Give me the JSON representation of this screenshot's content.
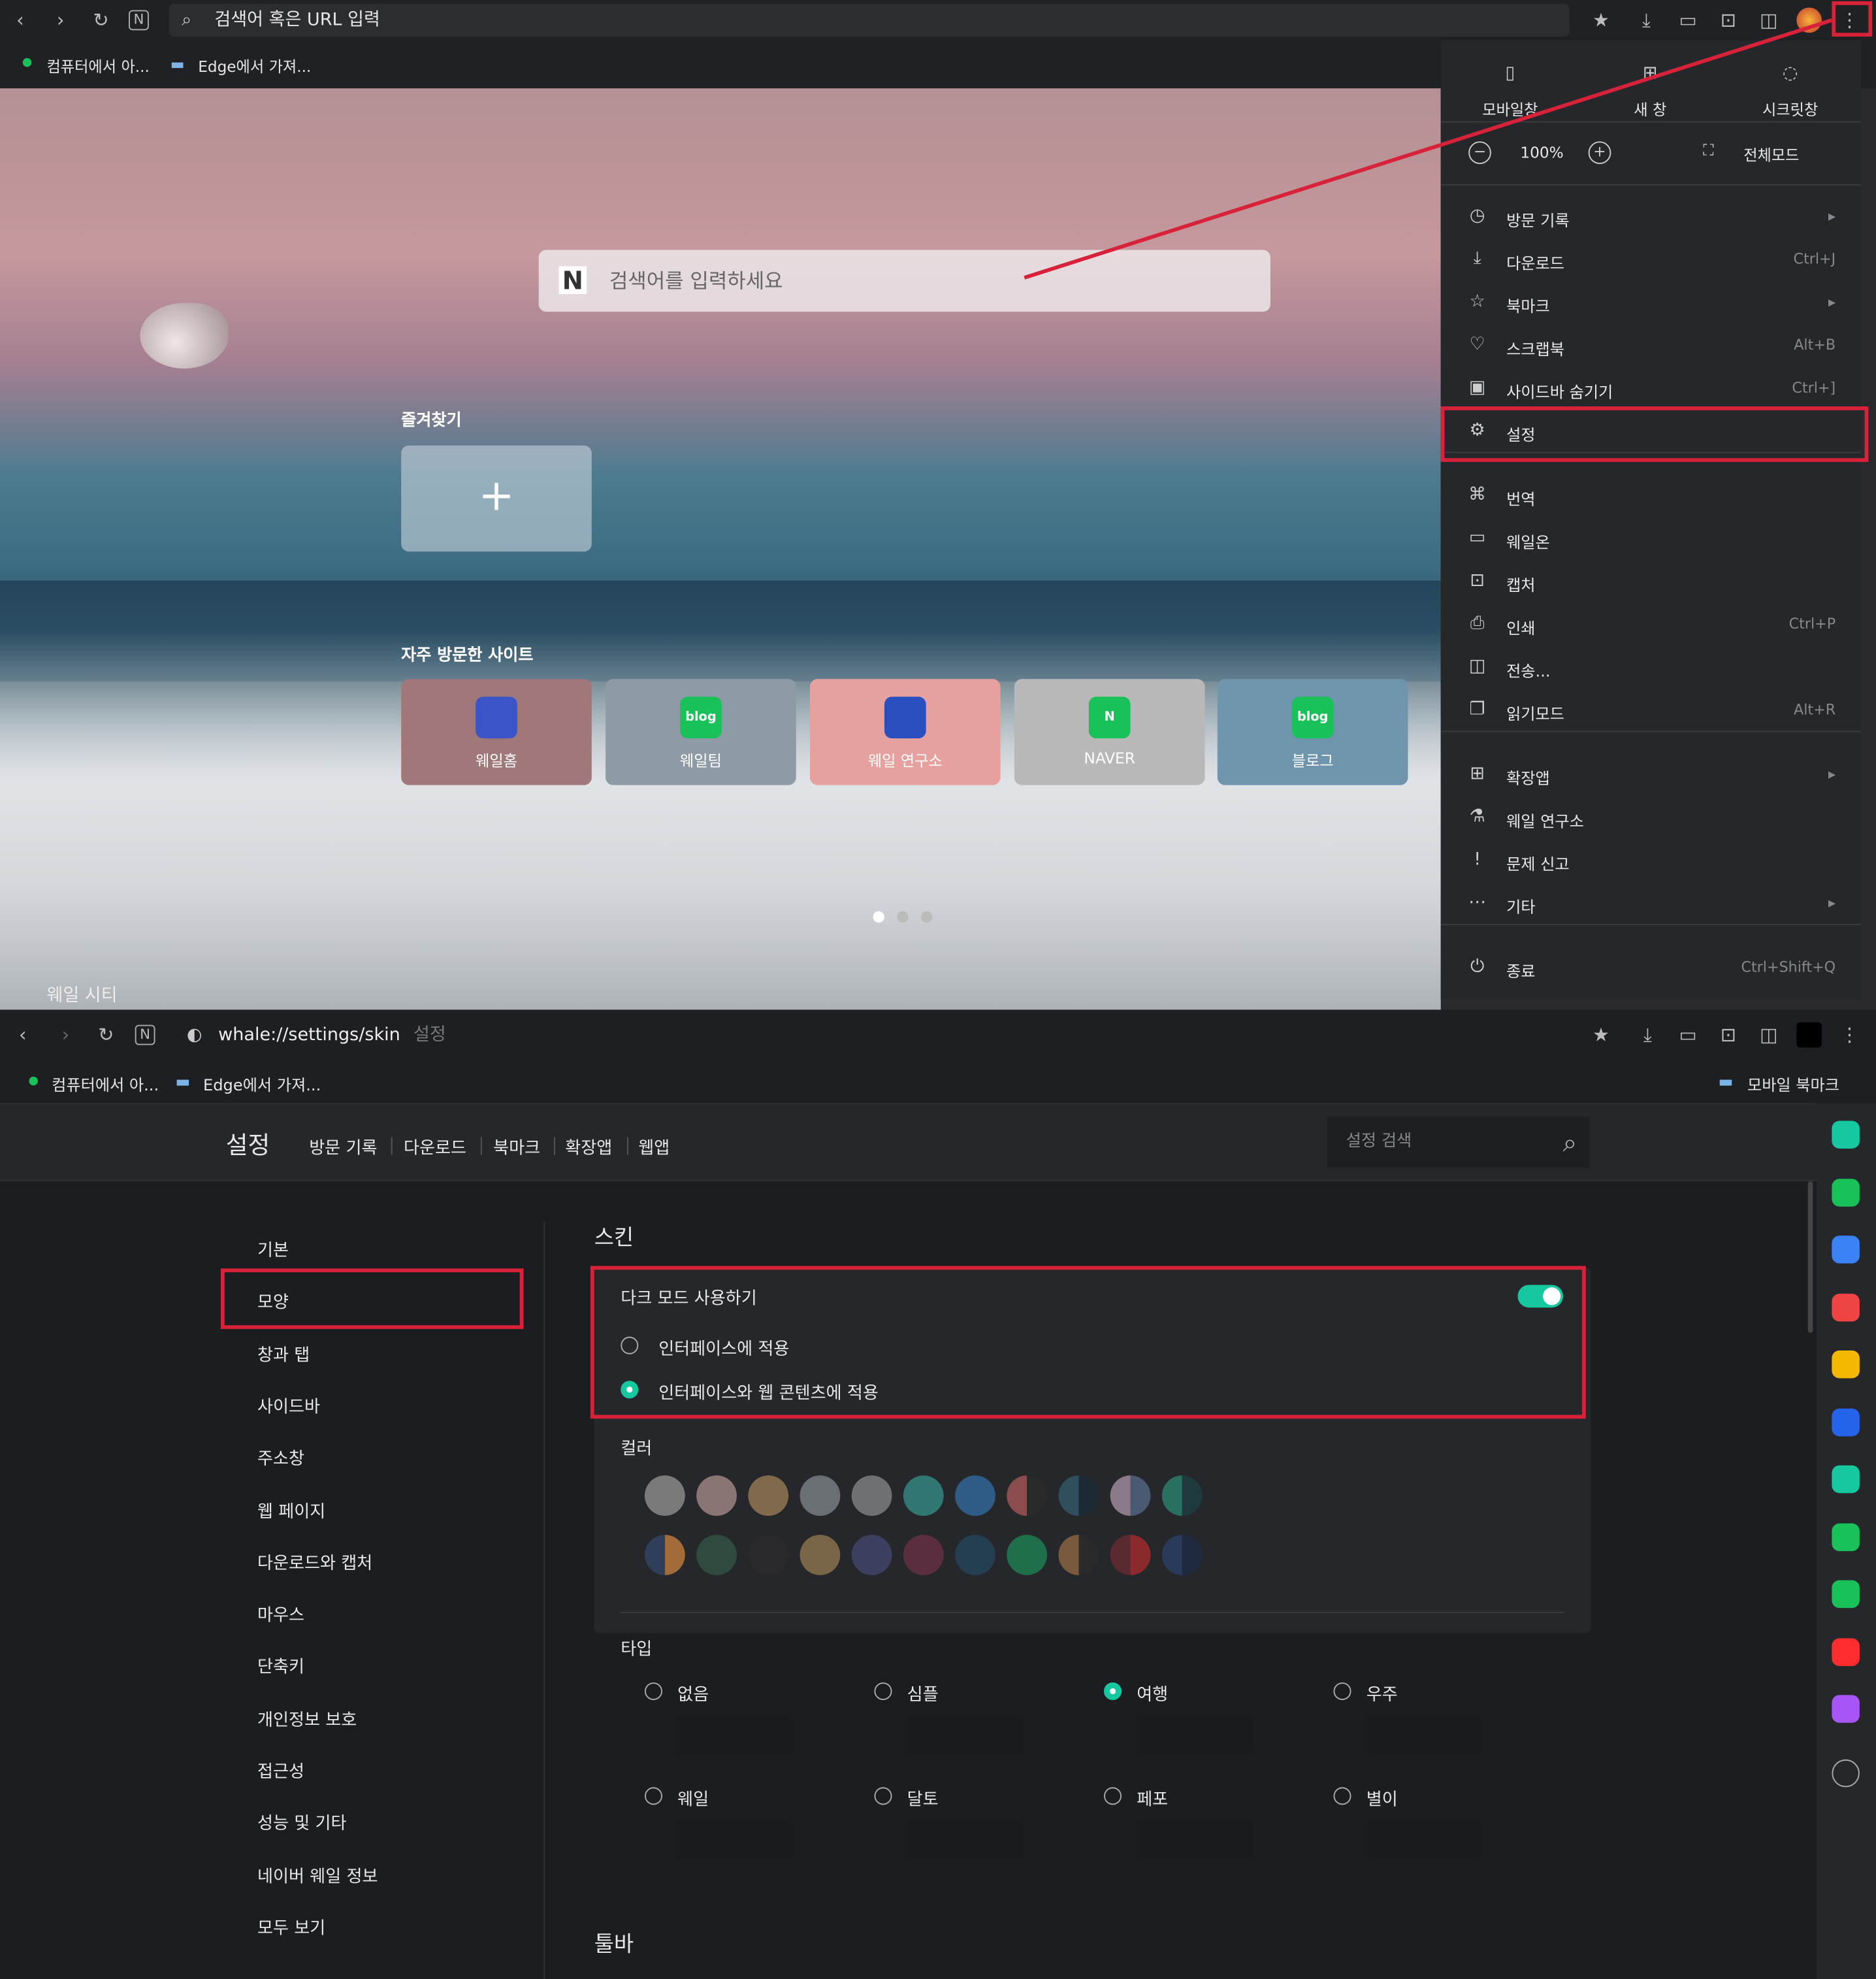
{
  "top": {
    "address_placeholder": "검색어 혹은 URL 입력",
    "bookmarks": [
      "컴퓨터에서 아...",
      "Edge에서 가져..."
    ],
    "search_placeholder": "검색어를 입력하세요",
    "favorites_title": "즐겨찾기",
    "frequent_title": "자주 방문한 사이트",
    "tiles": [
      {
        "label": "웨일홈",
        "bg": "#a0787a",
        "logo_bg": "#3b54c8",
        "logo": ""
      },
      {
        "label": "웨일팀",
        "bg": "#8e9aa6",
        "logo_bg": "#19c159",
        "logo": "blog"
      },
      {
        "label": "웨일 연구소",
        "bg": "#e6a09e",
        "logo_bg": "#2a4fbf",
        "logo": ""
      },
      {
        "label": "NAVER",
        "bg": "#b8b8b8",
        "logo_bg": "#19c159",
        "logo": "N"
      },
      {
        "label": "블로그",
        "bg": "#6f95ad",
        "logo_bg": "#19c159",
        "logo": "blog"
      }
    ],
    "city_label": "웨일 시티",
    "menu": {
      "window_buttons": [
        "모바일창",
        "새 창",
        "시크릿창"
      ],
      "zoom": "100%",
      "fullscreen": "전체모드",
      "items": [
        {
          "label": "방문 기록",
          "shortcut": "▸",
          "icon": "history-icon",
          "glyph": "◷"
        },
        {
          "label": "다운로드",
          "shortcut": "Ctrl+J",
          "icon": "download-icon",
          "glyph": "⤓"
        },
        {
          "label": "북마크",
          "shortcut": "▸",
          "icon": "star-icon",
          "glyph": "☆"
        },
        {
          "label": "스크랩북",
          "shortcut": "Alt+B",
          "icon": "scrapbook-icon",
          "glyph": "♡"
        },
        {
          "label": "사이드바 숨기기",
          "shortcut": "Ctrl+]",
          "icon": "sidebar-icon",
          "glyph": "▣"
        },
        {
          "label": "설정",
          "shortcut": "",
          "icon": "gear-icon",
          "glyph": "⚙"
        },
        {
          "label": "번역",
          "shortcut": "",
          "icon": "translate-icon",
          "glyph": "⌘"
        },
        {
          "label": "웨일온",
          "shortcut": "",
          "icon": "whaleon-icon",
          "glyph": "▭"
        },
        {
          "label": "캡처",
          "shortcut": "",
          "icon": "capture-icon",
          "glyph": "⊡"
        },
        {
          "label": "인쇄",
          "shortcut": "Ctrl+P",
          "icon": "print-icon",
          "glyph": "⎙"
        },
        {
          "label": "전송...",
          "shortcut": "",
          "icon": "cast-icon",
          "glyph": "◫"
        },
        {
          "label": "읽기모드",
          "shortcut": "Alt+R",
          "icon": "reader-icon",
          "glyph": "❐"
        },
        {
          "label": "확장앱",
          "shortcut": "▸",
          "icon": "extensions-icon",
          "glyph": "⊞"
        },
        {
          "label": "웨일 연구소",
          "shortcut": "",
          "icon": "lab-icon",
          "glyph": "⚗"
        },
        {
          "label": "문제 신고",
          "shortcut": "",
          "icon": "report-icon",
          "glyph": "!"
        },
        {
          "label": "기타",
          "shortcut": "▸",
          "icon": "more-icon",
          "glyph": "⋯"
        },
        {
          "label": "종료",
          "shortcut": "Ctrl+Shift+Q",
          "icon": "power-icon",
          "glyph": "⏻"
        }
      ]
    }
  },
  "bottom": {
    "url": "whale://settings/skin",
    "url_suffix": "설정",
    "bookmarks": [
      "컴퓨터에서 아...",
      "Edge에서 가져..."
    ],
    "mobile_bookmarks": "모바일 북마크",
    "settings_title": "설정",
    "header_nav": [
      "방문 기록",
      "다운로드",
      "북마크",
      "확장앱",
      "웹앱"
    ],
    "search_placeholder": "설정 검색",
    "nav": [
      "기본",
      "모양",
      "창과 탭",
      "사이드바",
      "주소창",
      "웹 페이지",
      "다운로드와 캡처",
      "마우스",
      "단축키",
      "개인정보 보호",
      "접근성",
      "성능 및 기타",
      "네이버 웨일 정보",
      "모두 보기"
    ],
    "skin_title": "스킨",
    "dark_mode": "다크 모드 사용하기",
    "dark_mode_on": true,
    "apply_options": [
      "인터페이스에 적용",
      "인터페이스와 웹 콘텐츠에 적용"
    ],
    "apply_selected": 1,
    "color_title": "컬러",
    "colors_row1": [
      "#7a7a7a",
      "#8a7575",
      "#80694d",
      "#6a6f73",
      "#6e7072",
      "#2f7770",
      "#2f5c86",
      "#8a4c4c|#2a2a2a",
      "#2f4f5f|#1c2a33",
      "#8a7a8a|#4a5a72",
      "#2a7060|#1f3a3f"
    ],
    "colors_row2": [
      "#2f3f5a|#a26b3a",
      "#2f4a3f",
      "#2a2a2c",
      "#7a6548",
      "#3c3f5e",
      "#5a2e3e",
      "#243f52",
      "#1f6f4a",
      "#7a5a3f|#2a2a2a",
      "#5a2a30|#8a2a2a",
      "#2a3a5a|#1f2a40"
    ],
    "type_title": "타입",
    "types": [
      "없음",
      "심플",
      "여행",
      "우주",
      "웨일",
      "달토",
      "페포",
      "별이"
    ],
    "type_selected": 2,
    "toolbar_title": "툴바",
    "sidebar_colors": [
      "#16c8a0",
      "#19c159",
      "#3b82f6",
      "#ef4444",
      "#f5b800",
      "#2563eb",
      "#16c8a0",
      "#19c159",
      "#19c159",
      "#ff2d2d",
      "#a855f7"
    ]
  }
}
